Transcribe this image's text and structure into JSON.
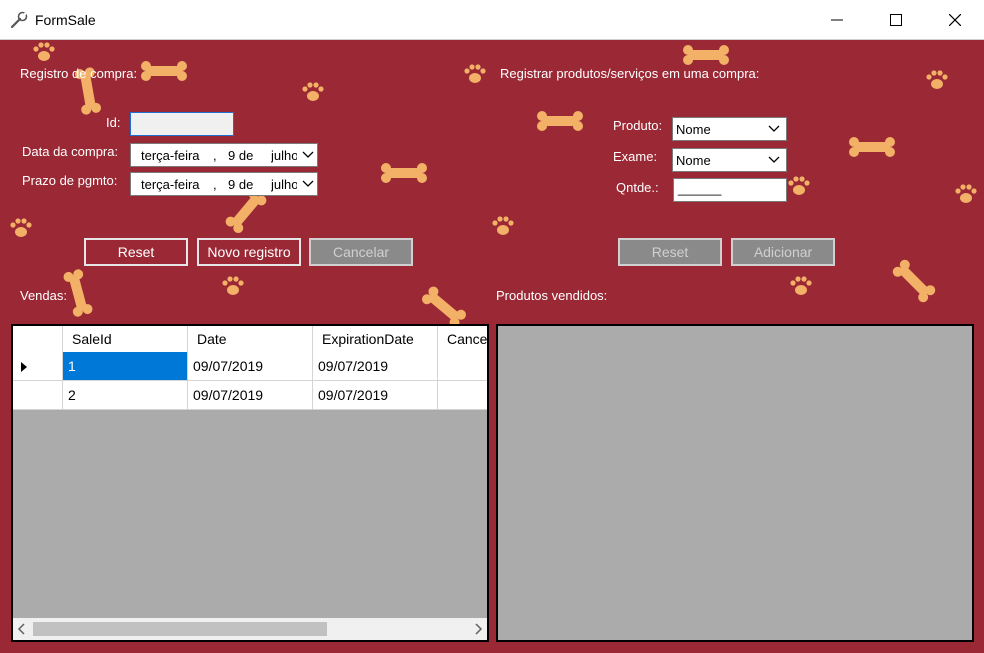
{
  "window": {
    "title": "FormSale"
  },
  "left": {
    "section_label": "Registro de compra:",
    "id_label": "Id:",
    "id_value": "",
    "date_label": "Data da compra:",
    "due_label": "Prazo de pgmto:",
    "date_picker": {
      "weekday": "terça-feira",
      "sep": ",",
      "day": "9 de",
      "month": "julho"
    },
    "due_picker": {
      "weekday": "terça-feira",
      "sep": ",",
      "day": "9 de",
      "month": "julho"
    },
    "reset_button": "Reset",
    "new_button": "Novo registro",
    "cancel_button": "Cancelar",
    "grid_label": "Vendas:"
  },
  "right": {
    "section_label": "Registrar produtos/serviços em uma compra:",
    "product_label": "Produto:",
    "product_value": "Nome",
    "exam_label": "Exame:",
    "exam_value": "Nome",
    "qty_label": "Qntde.:",
    "qty_value": "______",
    "reset_button": "Reset",
    "add_button": "Adicionar",
    "grid_label": "Produtos vendidos:"
  },
  "sales_grid": {
    "columns": [
      "SaleId",
      "Date",
      "ExpirationDate",
      "Cancel"
    ],
    "rows": [
      [
        "1",
        "09/07/2019",
        "09/07/2019",
        ""
      ],
      [
        "2",
        "09/07/2019",
        "09/07/2019",
        ""
      ]
    ]
  },
  "theme": {
    "background": "#9b2835",
    "decoration_color": "#f2b167",
    "selection": "#0078d7",
    "grid_empty": "#ababab"
  },
  "icons": {
    "app": "wrench-icon",
    "decor_bone": "bone-icon",
    "decor_paw": "paw-icon"
  }
}
